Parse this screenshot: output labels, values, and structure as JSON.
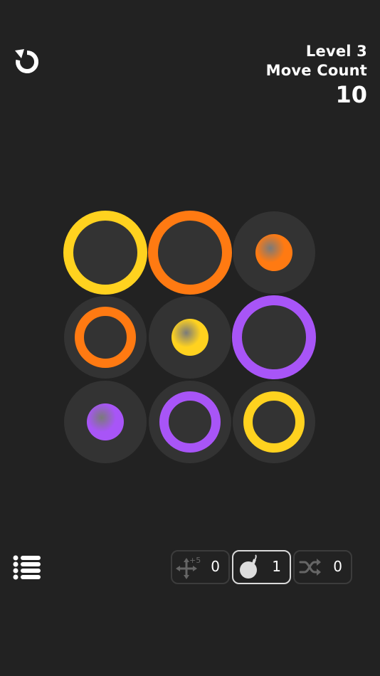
{
  "header": {
    "level_label": "Level 3",
    "move_count_label": "Move Count",
    "move_count_value": "10"
  },
  "icons": {
    "reset": "reset-icon",
    "menu": "menu-list-icon",
    "add_moves": "add-moves-icon",
    "bomb": "bomb-icon",
    "shuffle": "shuffle-icon"
  },
  "colors": {
    "background": "#222222",
    "cell": "#333333",
    "yellow": "#ffd21f",
    "orange": "#ff7a12",
    "purple": "#a855f7",
    "selected_border": "#d9d9d9",
    "inactive_icon": "#666666"
  },
  "board": {
    "rows": 3,
    "cols": 3,
    "cells": [
      {
        "row": 0,
        "col": 0,
        "pieces": [
          {
            "type": "ring-large",
            "color": "yellow"
          }
        ]
      },
      {
        "row": 0,
        "col": 1,
        "pieces": [
          {
            "type": "ring-large",
            "color": "orange"
          }
        ]
      },
      {
        "row": 0,
        "col": 2,
        "pieces": [
          {
            "type": "dot",
            "color": "orange"
          }
        ]
      },
      {
        "row": 1,
        "col": 0,
        "pieces": [
          {
            "type": "ring-medium",
            "color": "orange"
          }
        ]
      },
      {
        "row": 1,
        "col": 1,
        "pieces": [
          {
            "type": "dot",
            "color": "yellow"
          }
        ]
      },
      {
        "row": 1,
        "col": 2,
        "pieces": [
          {
            "type": "ring-large",
            "color": "purple"
          }
        ]
      },
      {
        "row": 2,
        "col": 0,
        "pieces": [
          {
            "type": "dot",
            "color": "purple"
          }
        ]
      },
      {
        "row": 2,
        "col": 1,
        "pieces": [
          {
            "type": "ring-medium",
            "color": "purple"
          }
        ]
      },
      {
        "row": 2,
        "col": 2,
        "pieces": [
          {
            "type": "ring-medium",
            "color": "yellow"
          }
        ]
      }
    ]
  },
  "powerups": [
    {
      "name": "add-moves",
      "icon": "add-moves-icon",
      "icon_text": "+5",
      "count": "0",
      "selected": false
    },
    {
      "name": "bomb",
      "icon": "bomb-icon",
      "count": "1",
      "selected": true
    },
    {
      "name": "shuffle",
      "icon": "shuffle-icon",
      "count": "0",
      "selected": false
    }
  ]
}
